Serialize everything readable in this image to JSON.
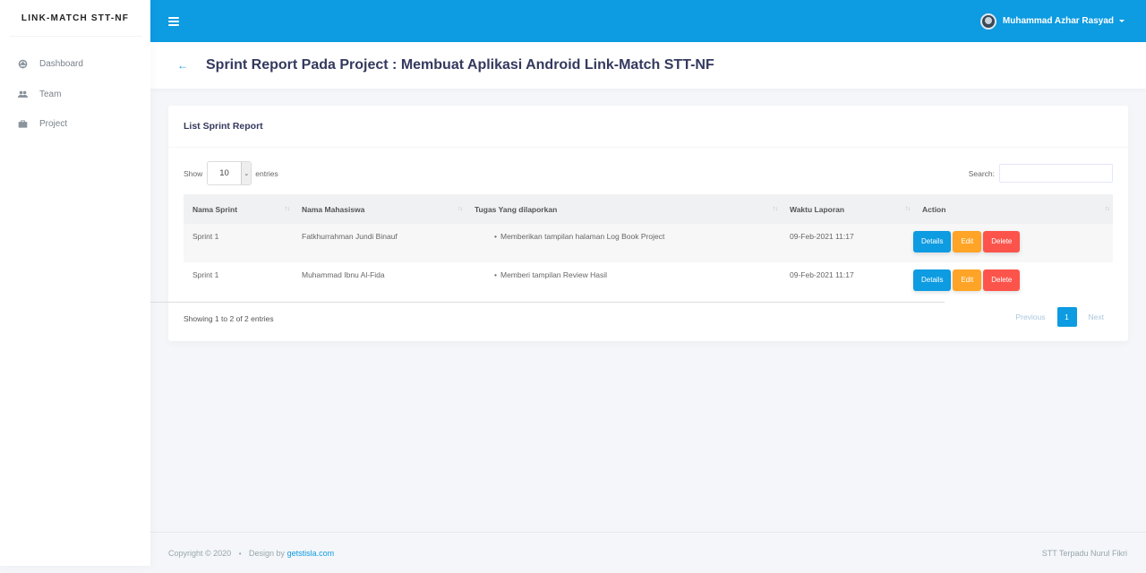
{
  "brand": "LINK-MATCH STT-NF",
  "sidebar": {
    "items": [
      {
        "label": "Dashboard",
        "icon": "dashboard-icon"
      },
      {
        "label": "Team",
        "icon": "users-icon"
      },
      {
        "label": "Project",
        "icon": "briefcase-icon"
      }
    ]
  },
  "topbar": {
    "user_name": "Muhammad Azhar Rasyad"
  },
  "header": {
    "title": "Sprint Report Pada Project : Membuat Aplikasi Android Link-Match STT-NF"
  },
  "card": {
    "title": "List Sprint Report",
    "show_label": "Show",
    "entries_value": "10",
    "entries_label": "entries",
    "search_label": "Search:",
    "search_value": ""
  },
  "table": {
    "headers": [
      "Nama Sprint",
      "Nama Mahasiswa",
      "Tugas Yang dilaporkan",
      "Waktu Laporan",
      "Action"
    ],
    "rows": [
      {
        "sprint": "Sprint 1",
        "mahasiswa": "Fatkhurrahman Jundi Binauf",
        "tugas": "Memberikan tampilan halaman Log Book Project",
        "waktu": "09-Feb-2021 11:17"
      },
      {
        "sprint": "Sprint 1",
        "mahasiswa": "Muhammad Ibnu Al-Fida",
        "tugas": "Memberi tampilan Review Hasil",
        "waktu": "09-Feb-2021 11:17"
      }
    ],
    "actions": {
      "details": "Details",
      "edit": "Edit",
      "delete": "Delete"
    }
  },
  "pagination": {
    "info": "Showing 1 to 2 of 2 entries",
    "previous": "Previous",
    "current": "1",
    "next": "Next"
  },
  "footer": {
    "copyright": "Copyright © 2020",
    "design_by": "Design by",
    "design_link": "getstisla.com",
    "right": "STT Terpadu Nurul Fikri"
  },
  "colors": {
    "primary": "#0d9be1",
    "warning": "#ffa426",
    "danger": "#fc544b"
  }
}
